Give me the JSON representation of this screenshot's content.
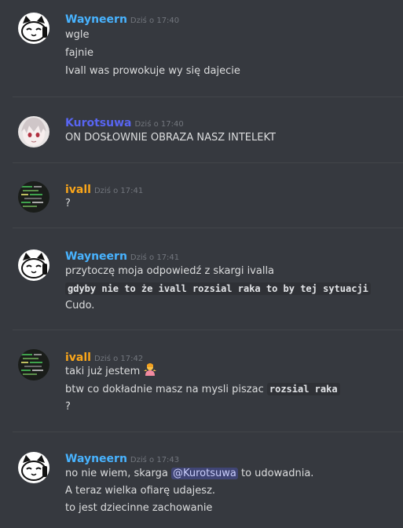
{
  "colors": {
    "background": "#36393f",
    "wayneern": "#48b3ff",
    "kurotsuwa": "#5865f2",
    "ivall": "#faa61a",
    "timestamp": "#72767d",
    "text": "#dcddde"
  },
  "messages": [
    {
      "author": "Wayneern",
      "timestamp": "Dziś o 17:40",
      "avatar": "cat-avatar-icon",
      "lines": [
        "wgle",
        "fajnie",
        "Ivall was prowokuje wy się dajecie"
      ]
    },
    {
      "author": "Kurotsuwa",
      "timestamp": "Dziś o 17:40",
      "avatar": "anime-girl-avatar-icon",
      "lines": [
        "ON DOSŁOWNIE OBRAZA NASZ INTELEKT"
      ]
    },
    {
      "author": "ivall",
      "timestamp": "Dziś o 17:41",
      "avatar": "code-avatar-icon",
      "lines": [
        "?"
      ]
    },
    {
      "author": "Wayneern",
      "timestamp": "Dziś o 17:41",
      "avatar": "cat-avatar-icon",
      "lines": [
        "przytoczę moja odpowiedź z skargi ivalla",
        "gdyby nie to że ivall rozsial raka to by tej sytuacji",
        "Cudo."
      ]
    },
    {
      "author": "ivall",
      "timestamp": "Dziś o 17:42",
      "avatar": "code-avatar-icon",
      "line1": "taki już jestem",
      "line1_emoji": "person-shrugging-emoji-icon",
      "line2_text": "btw co dokładnie masz na mysli piszac",
      "line2_code": "rozsial raka",
      "line3": "?"
    },
    {
      "author": "Wayneern",
      "timestamp": "Dziś o 17:43",
      "avatar": "cat-avatar-icon",
      "line1_pre": "no nie wiem, skarga",
      "line1_mention": "@Kurotsuwa",
      "line1_post": "to udowadnia.",
      "line2": "A teraz wielka ofiarę udajesz.",
      "line3": "to jest dziecinne zachowanie"
    }
  ]
}
